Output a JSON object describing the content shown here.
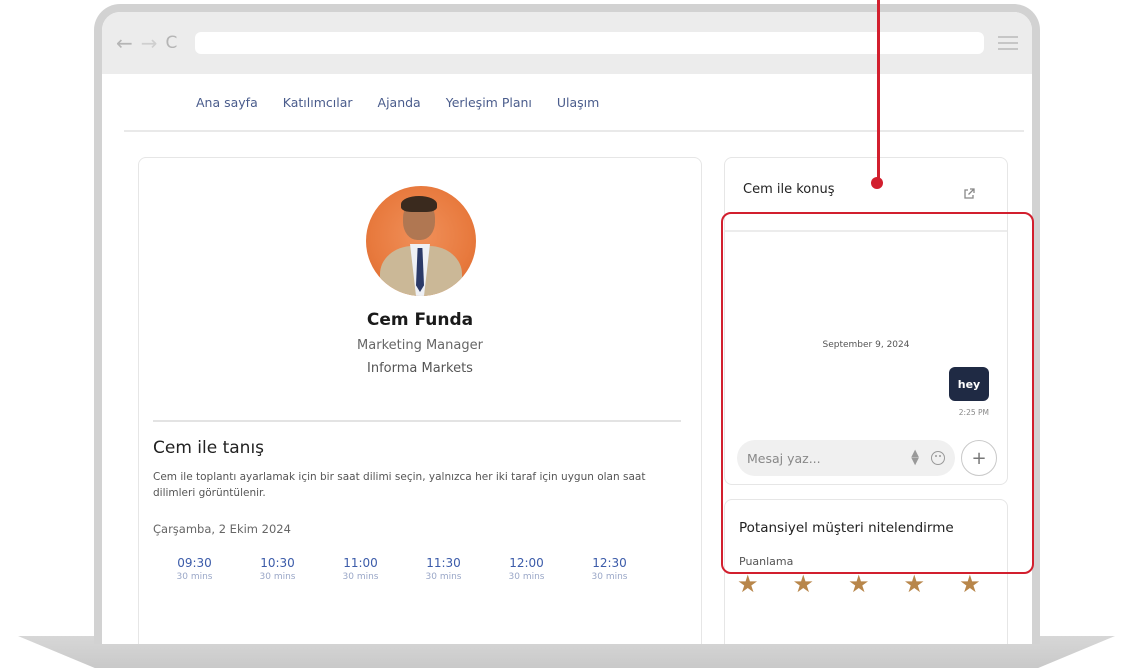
{
  "browser": {
    "back_icon": "←",
    "forward_icon": "→",
    "reload_icon": "C"
  },
  "nav": {
    "items": [
      "Ana sayfa",
      "Katılımcılar",
      "Ajanda",
      "Yerleşim Planı",
      "Ulaşım"
    ]
  },
  "profile": {
    "name": "Cem Funda",
    "role": "Marketing Manager",
    "company": "Informa Markets"
  },
  "meeting": {
    "title": "Cem ile tanış",
    "description": "Cem ile toplantı ayarlamak için bir saat dilimi seçin, yalnızca her iki taraf için uygun olan saat dilimleri görüntülenir.",
    "date": "Çarşamba, 2 Ekim 2024",
    "slots": [
      {
        "time": "09:30",
        "duration": "30 mins"
      },
      {
        "time": "10:30",
        "duration": "30 mins"
      },
      {
        "time": "11:00",
        "duration": "30 mins"
      },
      {
        "time": "11:30",
        "duration": "30 mins"
      },
      {
        "time": "12:00",
        "duration": "30 mins"
      },
      {
        "time": "12:30",
        "duration": "30 mins"
      }
    ]
  },
  "chat": {
    "title": "Cem ile konuş",
    "date_label": "September 9, 2024",
    "message": "hey",
    "message_time": "2:25 PM",
    "input_placeholder": "Mesaj yaz...",
    "plus_label": "+"
  },
  "qualification": {
    "title": "Potansiyel müşteri nitelendirme",
    "rating_label": "Puanlama",
    "stars_visible": 5,
    "star_color": "#b8864a"
  },
  "colors": {
    "annotation": "#d21f2e",
    "nav_link": "#4a5c8c",
    "slot_time": "#3b5ba9",
    "chat_bubble": "#1f2a44"
  }
}
